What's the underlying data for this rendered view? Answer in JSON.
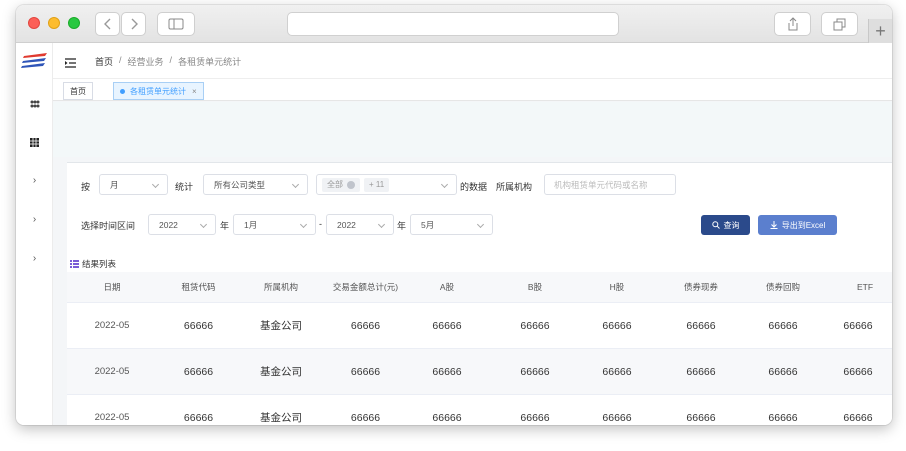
{
  "window": {
    "icons": {
      "back": "chevron-left-icon",
      "forward": "chevron-right-icon",
      "sidebar": "sidebar-icon",
      "share": "share-icon",
      "tabs": "tabs-icon",
      "new_tab": "+"
    }
  },
  "app": {
    "logo": "brand-logo",
    "sidebar": {
      "items": [
        {
          "icon": "apps-icon"
        },
        {
          "icon": "grid-icon"
        },
        {
          "icon": "chevron-right-icon",
          "glyph": "›"
        },
        {
          "icon": "chevron-right-icon",
          "glyph": "›"
        },
        {
          "icon": "chevron-right-icon",
          "glyph": "›"
        }
      ]
    },
    "breadcrumb": {
      "home": "首页",
      "sep1": "/",
      "level1": "经营业务",
      "sep2": "/",
      "level2": "各租赁单元统计"
    },
    "tabs": {
      "home": "首页",
      "active": "各租赁单元统计",
      "close": "×"
    }
  },
  "filters": {
    "by_label": "按",
    "period_value": "月",
    "stat_label": "统计",
    "company_type_value": "所有公司类型",
    "chips": {
      "all": "全部",
      "more": "+ 11"
    },
    "data_of_label": "的数据",
    "org_label": "所属机构",
    "search_placeholder": "机构租赁单元代码或名称",
    "range_label": "选择时间区间",
    "start_year": "2022",
    "year_unit_1": "年",
    "start_month": "1月",
    "dash": "-",
    "end_year": "2022",
    "year_unit_2": "年",
    "end_month": "5月",
    "query_button": "查询",
    "export_button": "导出到Excel"
  },
  "results": {
    "title": "结果列表",
    "columns": [
      "日期",
      "租赁代码",
      "所属机构",
      "交易金额总计(元)",
      "A股",
      "B股",
      "H股",
      "债券现券",
      "债券回购",
      "ETF"
    ],
    "rows": [
      [
        "2022-05",
        "66666",
        "基金公司",
        "66666",
        "66666",
        "66666",
        "66666",
        "66666",
        "66666",
        "66666"
      ],
      [
        "2022-05",
        "66666",
        "基金公司",
        "66666",
        "66666",
        "66666",
        "66666",
        "66666",
        "66666",
        "66666"
      ],
      [
        "2022-05",
        "66666",
        "基金公司",
        "66666",
        "66666",
        "66666",
        "66666",
        "66666",
        "66666",
        "66666"
      ]
    ]
  },
  "colors": {
    "primary": "#2b4a8b",
    "export": "#5b7fce",
    "accent": "#409eff",
    "list_icon": "#7b5cd6"
  }
}
